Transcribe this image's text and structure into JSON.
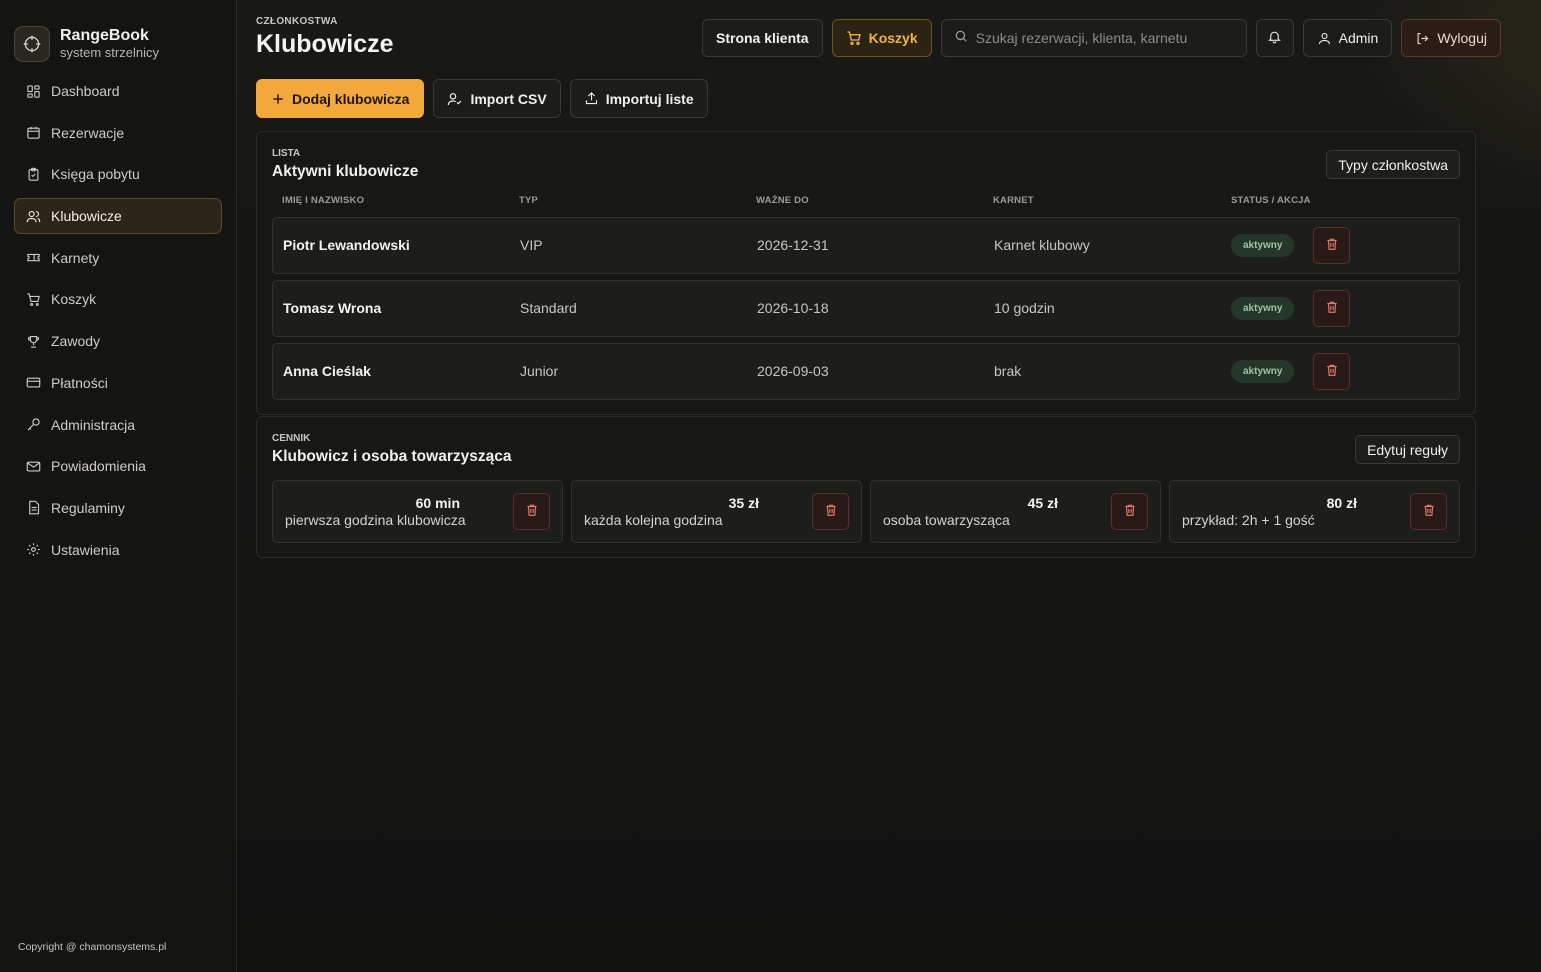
{
  "brand": {
    "name": "RangeBook",
    "subtitle": "system strzelnicy"
  },
  "nav": [
    {
      "label": "Dashboard",
      "icon": "grid-icon"
    },
    {
      "label": "Rezerwacje",
      "icon": "calendar-icon"
    },
    {
      "label": "Księga pobytu",
      "icon": "clipboard-icon"
    },
    {
      "label": "Klubowicze",
      "icon": "users-icon",
      "active": true
    },
    {
      "label": "Karnety",
      "icon": "ticket-icon"
    },
    {
      "label": "Koszyk",
      "icon": "cart-icon"
    },
    {
      "label": "Zawody",
      "icon": "trophy-icon"
    },
    {
      "label": "Płatności",
      "icon": "card-icon"
    },
    {
      "label": "Administracja",
      "icon": "key-icon"
    },
    {
      "label": "Powiadomienia",
      "icon": "mail-icon"
    },
    {
      "label": "Regulaminy",
      "icon": "document-icon"
    },
    {
      "label": "Ustawienia",
      "icon": "gear-icon"
    }
  ],
  "copyright": "Copyright @ chamonsystems.pl",
  "header": {
    "eyebrow": "CZŁONKOSTWA",
    "title": "Klubowicze"
  },
  "topbar": {
    "client_page": "Strona klienta",
    "cart": "Koszyk",
    "search_placeholder": "Szukaj rezerwacji, klienta, karnetu",
    "admin": "Admin",
    "logout": "Wyloguj"
  },
  "actions": {
    "add": "Dodaj klubowicza",
    "import_csv": "Import CSV",
    "import_list": "Importuj liste"
  },
  "members_panel": {
    "eyebrow": "LISTA",
    "title": "Aktywni klubowicze",
    "button": "Typy członkostwa",
    "columns": [
      "IMIĘ I NAZWISKO",
      "TYP",
      "WAŻNE DO",
      "KARNET",
      "STATUS / AKCJA"
    ],
    "rows": [
      {
        "name": "Piotr Lewandowski",
        "type": "VIP",
        "valid_until": "2026-12-31",
        "pass": "Karnet klubowy",
        "status": "aktywny"
      },
      {
        "name": "Tomasz Wrona",
        "type": "Standard",
        "valid_until": "2026-10-18",
        "pass": "10 godzin",
        "status": "aktywny"
      },
      {
        "name": "Anna Cieślak",
        "type": "Junior",
        "valid_until": "2026-09-03",
        "pass": "brak",
        "status": "aktywny"
      }
    ]
  },
  "pricing_panel": {
    "eyebrow": "CENNIK",
    "title": "Klubowicz i osoba towarzysząca",
    "button": "Edytuj reguły",
    "items": [
      {
        "amount": "60 min",
        "desc": "pierwsza godzina klubowicza"
      },
      {
        "amount": "35 zł",
        "desc": "każda kolejna godzina"
      },
      {
        "amount": "45 zł",
        "desc": "osoba towarzysząca"
      },
      {
        "amount": "80 zł",
        "desc": "przykład: 2h + 1 gość"
      }
    ]
  },
  "colors": {
    "accent": "#f2a83a",
    "danger": "#e0796a",
    "success": "#9fc3a6"
  }
}
